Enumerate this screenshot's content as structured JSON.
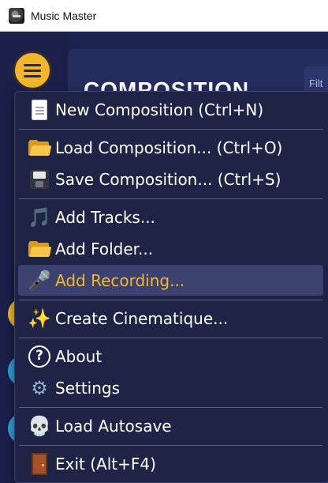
{
  "window": {
    "title": "Music Master"
  },
  "main": {
    "heading": "COMPOSITION",
    "filter_placeholder": "Filt"
  },
  "menu": {
    "items": [
      {
        "label": "New Composition (Ctrl+N)",
        "icon": "new-document-icon"
      },
      {
        "label": "Load Composition... (Ctrl+O)",
        "icon": "open-folder-icon"
      },
      {
        "label": "Save Composition... (Ctrl+S)",
        "icon": "floppy-disk-icon"
      },
      {
        "label": "Add Tracks...",
        "icon": "music-note-icon"
      },
      {
        "label": "Add Folder...",
        "icon": "open-folder-icon"
      },
      {
        "label": "Add Recording...",
        "icon": "microphone-icon",
        "highlighted": true
      },
      {
        "label": "Create Cinematique...",
        "icon": "sparkles-icon"
      },
      {
        "label": "About",
        "icon": "question-circle-icon"
      },
      {
        "label": "Settings",
        "icon": "gear-icon"
      },
      {
        "label": "Load Autosave",
        "icon": "skull-icon"
      },
      {
        "label": "Exit (Alt+F4)",
        "icon": "door-icon"
      }
    ]
  },
  "colors": {
    "accent": "#f2b52b",
    "highlight_text": "#f4b72c",
    "menu_background": "#1f2447",
    "panel_background": "#252d5e",
    "app_background": "#1c2350"
  }
}
